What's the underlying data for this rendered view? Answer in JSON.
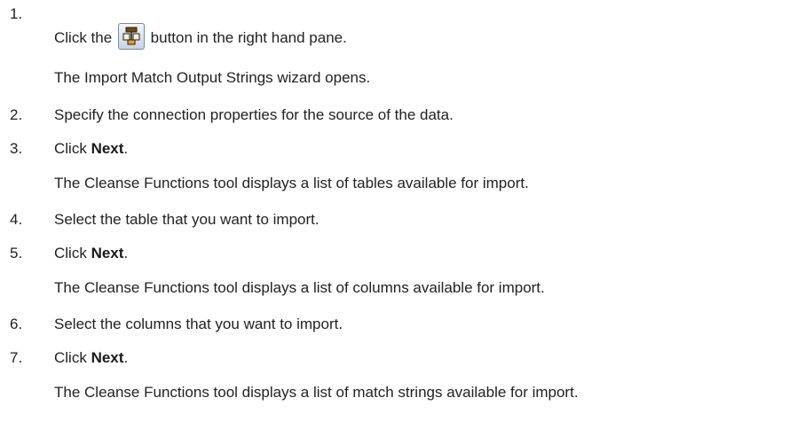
{
  "steps": [
    {
      "number": "1.",
      "pre": "Click the",
      "post": "button in the right hand pane.",
      "icon": "import-match-output-strings-icon",
      "note": "The Import Match Output Strings wizard opens."
    },
    {
      "number": "2.",
      "text": "Specify the connection properties for the source of the data."
    },
    {
      "number": "3.",
      "pre": "Click",
      "bold": "Next",
      "post": ".",
      "note": "The Cleanse Functions tool displays a list of tables available for import."
    },
    {
      "number": "4.",
      "text": "Select the table that you want to import."
    },
    {
      "number": "5.",
      "pre": "Click",
      "bold": "Next",
      "post": ".",
      "note": "The Cleanse Functions tool displays a list of columns available for import."
    },
    {
      "number": "6.",
      "text": "Select the columns that you want to import."
    },
    {
      "number": "7.",
      "pre": "Click",
      "bold": "Next",
      "post": ".",
      "note": "The Cleanse Functions tool displays a list of match strings available for import."
    }
  ]
}
